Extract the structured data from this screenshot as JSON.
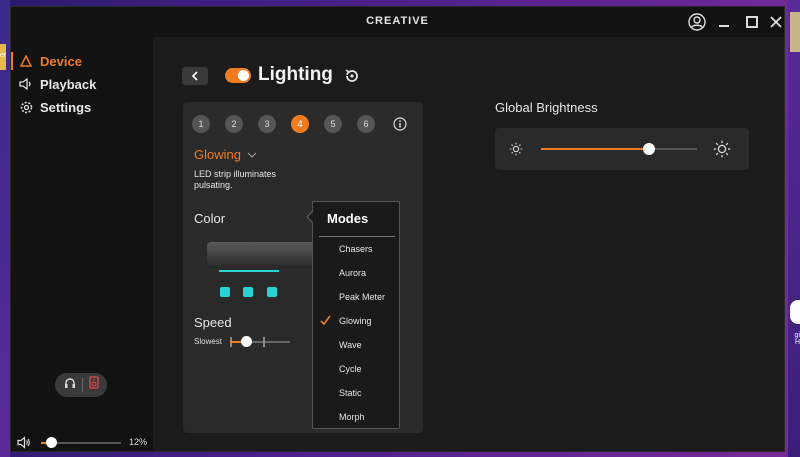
{
  "window": {
    "brand": "CREATIVE"
  },
  "desktop": {
    "left_label": "er",
    "right_label": "gi H"
  },
  "sidebar": {
    "items": [
      {
        "label": "Device",
        "icon": "device-triangle-icon",
        "active": true
      },
      {
        "label": "Playback",
        "icon": "speaker-icon",
        "active": false
      },
      {
        "label": "Settings",
        "icon": "gear-icon",
        "active": false
      }
    ],
    "output": {
      "headphones_icon": "headphones-icon",
      "speaker_icon": "speaker-device-icon",
      "selected": "speaker"
    },
    "volume": {
      "percent_label": "12%",
      "value": 0.12
    }
  },
  "header": {
    "title": "Lighting",
    "enabled": true
  },
  "lighting": {
    "zones": [
      "1",
      "2",
      "3",
      "4",
      "5",
      "6"
    ],
    "active_zone": "4",
    "mode_selected": "Glowing",
    "description": "LED strip illuminates pulsating.",
    "color_label": "Color",
    "speed_label": "Speed",
    "speed_min_label": "Slowest",
    "speed_value": 0.25,
    "accent_color": "#f07c1f",
    "led_color": "#29d3d6"
  },
  "modes_dropdown": {
    "title": "Modes",
    "items": [
      "Chasers",
      "Aurora",
      "Peak Meter",
      "Glowing",
      "Wave",
      "Cycle",
      "Static",
      "Morph"
    ],
    "checked": "Glowing"
  },
  "brightness": {
    "label": "Global Brightness",
    "value": 0.69
  }
}
